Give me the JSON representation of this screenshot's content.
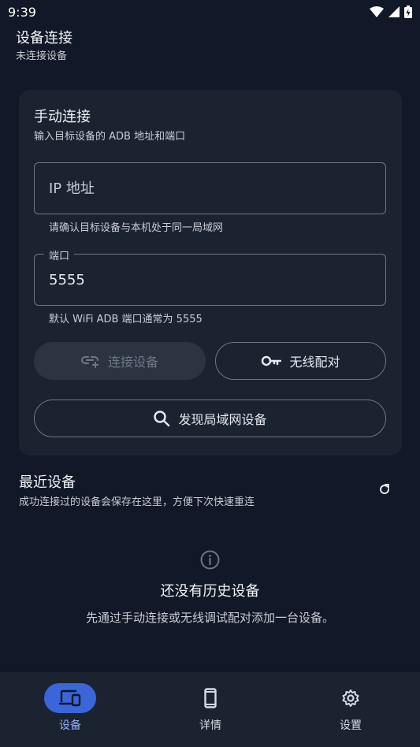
{
  "status_bar": {
    "time": "9:39"
  },
  "header": {
    "title": "设备连接",
    "subtitle": "未连接设备"
  },
  "manual": {
    "title": "手动连接",
    "subtitle": "输入目标设备的 ADB 地址和端口",
    "ip_field": {
      "placeholder": "IP 地址",
      "value": "",
      "helper": "请确认目标设备与本机处于同一局域网"
    },
    "port_field": {
      "label": "端口",
      "value": "5555",
      "helper": "默认 WiFi ADB 端口通常为 5555"
    },
    "connect_label": "连接设备",
    "pair_label": "无线配对",
    "discover_label": "发现局域网设备"
  },
  "recent": {
    "title": "最近设备",
    "subtitle": "成功连接过的设备会保存在这里，方便下次快速重连",
    "empty_title": "还没有历史设备",
    "empty_desc": "先通过手动连接或无线调试配对添加一台设备。"
  },
  "nav": {
    "items": [
      {
        "label": "设备",
        "icon": "devices-icon",
        "active": true
      },
      {
        "label": "详情",
        "icon": "phone-icon",
        "active": false
      },
      {
        "label": "设置",
        "icon": "gear-icon",
        "active": false
      }
    ]
  },
  "colors": {
    "background": "#111827",
    "card": "#1b2331",
    "accent": "#3a66d9",
    "accent_text": "#8fb2ff"
  }
}
